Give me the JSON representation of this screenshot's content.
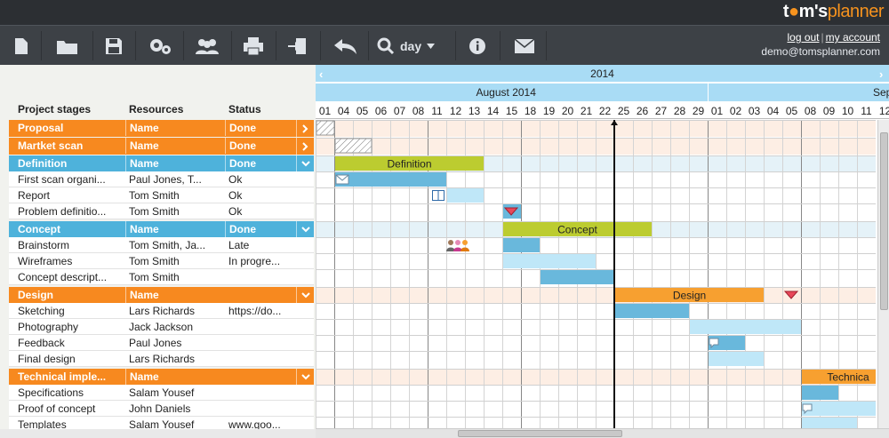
{
  "header": {
    "logo_pre": "t",
    "logo_mid": "m's",
    "logo_post": "planner",
    "day_view": "day",
    "logout": "log out",
    "separator": "|",
    "my_account": "my account",
    "email": "demo@tomsplanner.com"
  },
  "colors": {
    "orange": "#f7891f",
    "blue": "#4eb2db",
    "olive": "#bccc30",
    "bar_blue": "#69b8dc",
    "bar_light": "#bfe7f8"
  },
  "columns": {
    "stage": "Project stages",
    "resources": "Resources",
    "status": "Status"
  },
  "timeline": {
    "year": "2014",
    "months": [
      {
        "label": "August 2014",
        "start": 0,
        "end": 20
      },
      {
        "label": "Sep",
        "start": 21,
        "end": 31
      }
    ],
    "days": [
      "01",
      "04",
      "05",
      "06",
      "07",
      "08",
      "11",
      "12",
      "13",
      "14",
      "15",
      "18",
      "19",
      "20",
      "21",
      "22",
      "25",
      "26",
      "27",
      "28",
      "29",
      "01",
      "02",
      "03",
      "04",
      "05",
      "08",
      "09",
      "10",
      "11",
      "12"
    ]
  },
  "rows": [
    {
      "type": "group",
      "color": "orange",
      "name": "Proposal",
      "resources": "Name",
      "status": "Done",
      "toggle": "collapsed"
    },
    {
      "type": "group",
      "color": "orange",
      "name": "Martket scan",
      "resources": "Name",
      "status": "Done",
      "toggle": "collapsed"
    },
    {
      "type": "group",
      "color": "blue",
      "name": "Definition",
      "resources": "Name",
      "status": "Done",
      "toggle": "expanded"
    },
    {
      "type": "task",
      "name": "First scan organi...",
      "resources": "Paul Jones, T...",
      "status": "Ok"
    },
    {
      "type": "task",
      "name": "Report",
      "resources": "Tom Smith",
      "status": "Ok"
    },
    {
      "type": "task",
      "name": "Problem definitio...",
      "resources": "Tom Smith",
      "status": "Ok"
    },
    {
      "type": "group",
      "color": "blue",
      "name": "Concept",
      "resources": "Name",
      "status": "Done",
      "toggle": "expanded"
    },
    {
      "type": "task",
      "name": "Brainstorm",
      "resources": "Tom Smith, Ja...",
      "status": "Late"
    },
    {
      "type": "task",
      "name": "Wireframes",
      "resources": "Tom Smith",
      "status": "In progre..."
    },
    {
      "type": "task",
      "name": "Concept descript...",
      "resources": "Tom Smith",
      "status": ""
    },
    {
      "type": "group",
      "color": "orange",
      "name": "Design",
      "resources": "Name",
      "status": "",
      "toggle": "expanded"
    },
    {
      "type": "task",
      "name": "Sketching",
      "resources": "Lars Richards",
      "status": "https://do..."
    },
    {
      "type": "task",
      "name": "Photography",
      "resources": "Jack Jackson",
      "status": ""
    },
    {
      "type": "task",
      "name": "Feedback",
      "resources": "Paul Jones",
      "status": ""
    },
    {
      "type": "task",
      "name": "Final design",
      "resources": "Lars Richards",
      "status": ""
    },
    {
      "type": "group",
      "color": "orange",
      "name": "Technical imple...",
      "resources": "Name",
      "status": "",
      "toggle": "expanded"
    },
    {
      "type": "task",
      "name": "Specifications",
      "resources": "Salam Yousef",
      "status": ""
    },
    {
      "type": "task",
      "name": "Proof of concept",
      "resources": "John Daniels",
      "status": ""
    },
    {
      "type": "task",
      "name": "Templates",
      "resources": "Salam Yousef",
      "status": "www.goo..."
    }
  ],
  "bars": [
    {
      "row": 0,
      "start": 0,
      "end": 0,
      "style": "hatch"
    },
    {
      "row": 1,
      "start": 1,
      "end": 2,
      "style": "hatch"
    },
    {
      "row": 2,
      "start": 1,
      "end": 8,
      "style": "olive",
      "label": "Definition"
    },
    {
      "row": 3,
      "start": 1,
      "end": 6,
      "style": "blue",
      "icon": "mail-icon"
    },
    {
      "row": 4,
      "start": 7,
      "end": 8,
      "style": "light",
      "icon": "book-icon"
    },
    {
      "row": 5,
      "start": 10,
      "end": 10,
      "style": "blue"
    },
    {
      "row": 6,
      "start": 10,
      "end": 17,
      "style": "olive",
      "label": "Concept"
    },
    {
      "row": 7,
      "start": 10,
      "end": 11,
      "style": "blue",
      "icon": "people-icon"
    },
    {
      "row": 8,
      "start": 10,
      "end": 14,
      "style": "light"
    },
    {
      "row": 9,
      "start": 12,
      "end": 15,
      "style": "blue"
    },
    {
      "row": 10,
      "start": 16,
      "end": 23,
      "style": "orange",
      "label": "Design"
    },
    {
      "row": 11,
      "start": 16,
      "end": 19,
      "style": "blue"
    },
    {
      "row": 12,
      "start": 20,
      "end": 25,
      "style": "light"
    },
    {
      "row": 13,
      "start": 21,
      "end": 22,
      "style": "blue",
      "icon": "comment-icon"
    },
    {
      "row": 14,
      "start": 21,
      "end": 23,
      "style": "light"
    },
    {
      "row": 15,
      "start": 26,
      "end": 30,
      "style": "orange",
      "label": "Technica"
    },
    {
      "row": 16,
      "start": 26,
      "end": 27,
      "style": "blue"
    },
    {
      "row": 17,
      "start": 26,
      "end": 29,
      "style": "light",
      "icon": "comment-icon"
    },
    {
      "row": 18,
      "start": 26,
      "end": 28,
      "style": "light"
    }
  ],
  "milestones": [
    {
      "row": 5,
      "day": 10
    },
    {
      "row": 10,
      "day": 25
    }
  ],
  "today_marker": {
    "day": 16
  }
}
